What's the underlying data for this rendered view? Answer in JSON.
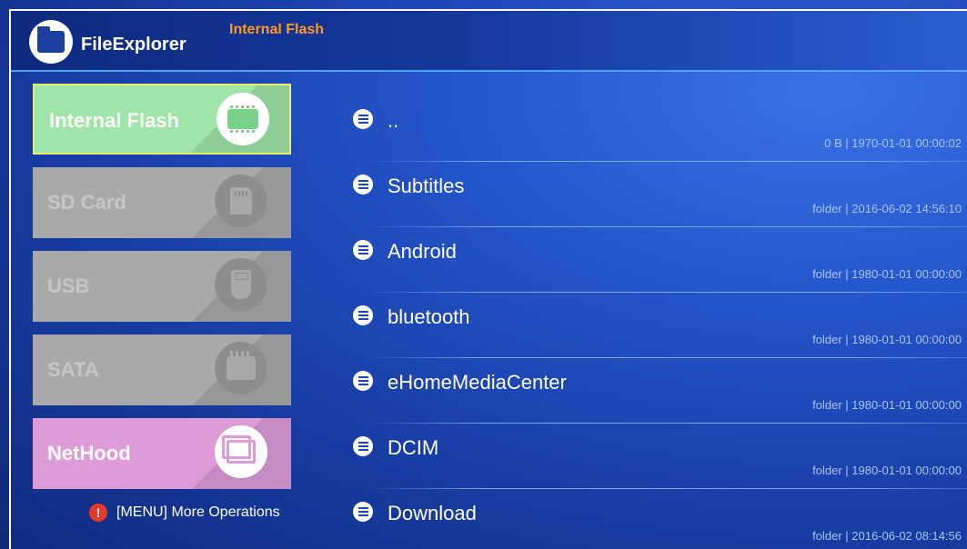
{
  "header": {
    "app_title": "FileExplorer",
    "current_path": "Internal Flash"
  },
  "sidebar": {
    "items": [
      {
        "label": "Internal Flash",
        "icon": "chip-icon",
        "state": "selected",
        "color": "#9fe4a8"
      },
      {
        "label": "SD Card",
        "icon": "sd-card-icon",
        "state": "disabled",
        "color": "#a9a9ab"
      },
      {
        "label": "USB",
        "icon": "usb-icon",
        "state": "disabled",
        "color": "#a9a9ab"
      },
      {
        "label": "SATA",
        "icon": "sata-icon",
        "state": "disabled",
        "color": "#a9a9ab"
      },
      {
        "label": "NetHood",
        "icon": "network-window-icon",
        "state": "normal",
        "color": "#dd9bd8"
      }
    ],
    "hint": "[MENU] More Operations"
  },
  "files": [
    {
      "name": "..",
      "meta": "0 B | 1970-01-01 00:00:02"
    },
    {
      "name": "Subtitles",
      "meta": "folder | 2016-06-02 14:56:10"
    },
    {
      "name": "Android",
      "meta": "folder | 1980-01-01 00:00:00"
    },
    {
      "name": "bluetooth",
      "meta": "folder | 1980-01-01 00:00:00"
    },
    {
      "name": "eHomeMediaCenter",
      "meta": "folder | 1980-01-01 00:00:00"
    },
    {
      "name": "DCIM",
      "meta": "folder | 1980-01-01 00:00:00"
    },
    {
      "name": "Download",
      "meta": "folder | 2016-06-02 08:14:56"
    }
  ],
  "colors": {
    "accent_orange": "#ff9a1f",
    "header_line": "#4ea3f0",
    "warning_red": "#e23b2b"
  }
}
